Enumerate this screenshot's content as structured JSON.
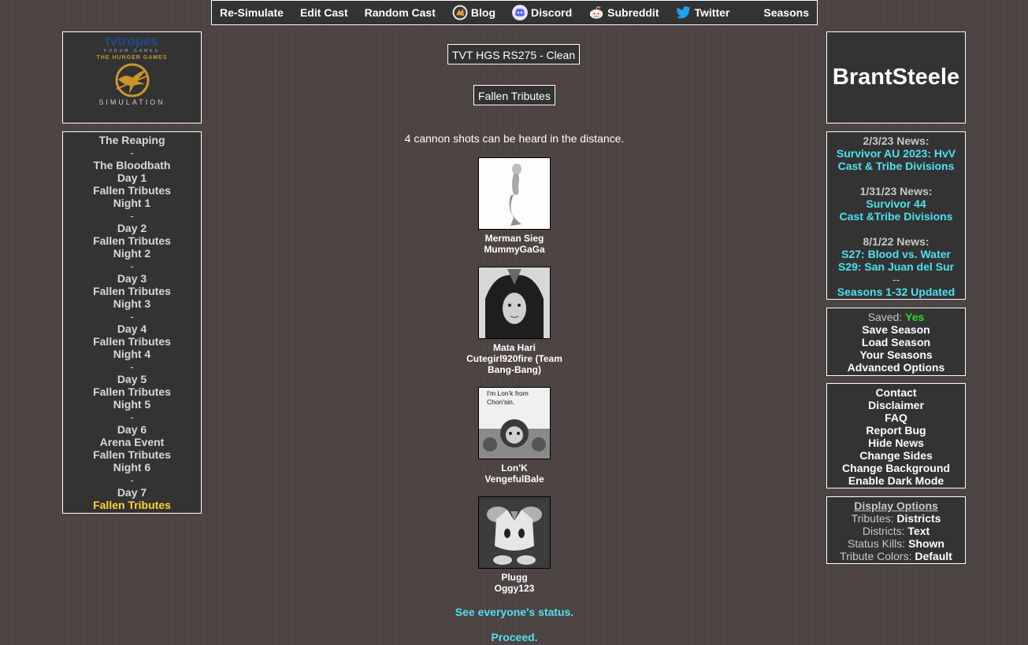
{
  "nav": {
    "items": [
      {
        "label": "Re-Simulate"
      },
      {
        "label": "Edit Cast"
      },
      {
        "label": "Random Cast"
      },
      {
        "label": "Blog",
        "icon": "blog-icon"
      },
      {
        "label": "Discord",
        "icon": "discord-icon"
      },
      {
        "label": "Subreddit",
        "icon": "reddit-icon"
      },
      {
        "label": "Twitter",
        "icon": "twitter-icon"
      },
      {
        "label": "Seasons"
      }
    ]
  },
  "logo": {
    "line1": "tvtropes",
    "line2": "FORUM GAMES",
    "line3": "THE HUNGER GAMES",
    "line4": "SIMULATION"
  },
  "leftnav": {
    "items": [
      "The Reaping",
      "-",
      "The Bloodbath",
      "Day 1",
      "Fallen Tributes",
      "Night 1",
      "-",
      "Day 2",
      "Fallen Tributes",
      "Night 2",
      "-",
      "Day 3",
      "Fallen Tributes",
      "Night 3",
      "-",
      "Day 4",
      "Fallen Tributes",
      "Night 4",
      "-",
      "Day 5",
      "Fallen Tributes",
      "Night 5",
      "-",
      "Day 6",
      "Arena Event",
      "Fallen Tributes",
      "Night 6",
      "-",
      "Day 7",
      "Fallen Tributes"
    ],
    "active_index": 29
  },
  "main": {
    "season_title": "TVT HGS RS275 - Clean",
    "section_title": "Fallen Tributes",
    "cannon_text": "4 cannon shots can be heard in the distance.",
    "tributes": [
      {
        "name": "Merman Sieg",
        "player": "MummyGaGa"
      },
      {
        "name": "Mata Hari",
        "player": "Cutegirl920fire (Team Bang-Bang)"
      },
      {
        "name": "Lon'K",
        "player": "VengefulBale",
        "portrait_caption": "I'm Lon'k from Chon'sin."
      },
      {
        "name": "Plugg",
        "player": "Oggy123"
      }
    ],
    "status_link": "See everyone's status.",
    "proceed_link": "Proceed."
  },
  "brand": {
    "name": "BrantSteele"
  },
  "news": {
    "entries": [
      {
        "date": "2/3/23 News:",
        "links": [
          "Survivor AU 2023: HvV",
          "Cast & Tribe Divisions"
        ]
      },
      {
        "date": "1/31/23 News:",
        "links": [
          "Survivor 44",
          "Cast &Tribe Divisions"
        ]
      },
      {
        "date": "8/1/22 News:",
        "links": [
          "S27: Blood vs. Water",
          "S29: San Juan del Sur"
        ]
      }
    ],
    "separator": "--",
    "footer_link": "Seasons 1-32 Updated"
  },
  "save": {
    "saved_label": "Saved:",
    "saved_value": "Yes",
    "saved_color": "#22dd22",
    "links": [
      "Save Season",
      "Load Season",
      "Your Seasons",
      "Advanced Options"
    ]
  },
  "contact": {
    "links": [
      "Contact",
      "Disclaimer",
      "FAQ",
      "Report Bug",
      "Hide News",
      "Change Sides",
      "Change Background",
      "Enable Dark Mode"
    ]
  },
  "display": {
    "title": "Display Options",
    "options": [
      {
        "label": "Tributes:",
        "value": "Districts"
      },
      {
        "label": "Districts:",
        "value": "Text"
      },
      {
        "label": "Status Kills:",
        "value": "Shown"
      },
      {
        "label": "Tribute Colors:",
        "value": "Default"
      }
    ]
  },
  "colors": {
    "link": "#4fe1f0",
    "active": "#ffd630",
    "panel": "#333333"
  }
}
